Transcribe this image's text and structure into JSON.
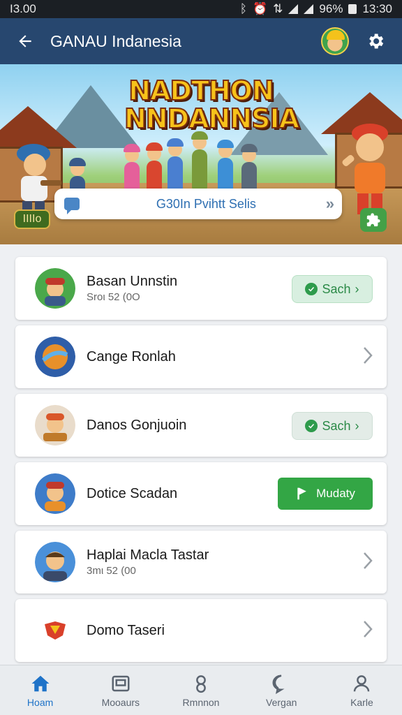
{
  "status_bar": {
    "time_left": "Ι3.00",
    "icons": [
      "bluetooth-icon",
      "alarm-icon",
      "network-icon",
      "signal-icon",
      "signal-icon",
      "battery-icon"
    ],
    "battery": "96%",
    "time_right": "13:30"
  },
  "app_bar": {
    "back_icon": "arrow-left-icon",
    "title": "GANAU Indanesia",
    "settings_icon": "gear-icon"
  },
  "hero": {
    "title_line1": "NADTHON",
    "title_line2": "NNDANNSIA",
    "search_placeholder": "G30In Pvihtt Selis",
    "search_chevron": "»",
    "badge": "ΙΙΙΙο"
  },
  "list": [
    {
      "name": "Basan Unnstin",
      "sub": "Sroι 52 (0O",
      "action": {
        "type": "button-light",
        "label": "Sach",
        "trail": "›"
      }
    },
    {
      "name": "Cange Ronlah",
      "sub": "",
      "action": {
        "type": "chevron"
      }
    },
    {
      "name": "Danos Gonjuoin",
      "sub": "",
      "action": {
        "type": "button-grey",
        "label": "Sach",
        "trail": "›"
      }
    },
    {
      "name": "Dotice Scadan",
      "sub": "",
      "action": {
        "type": "button-green",
        "label": "Mudaty"
      }
    },
    {
      "name": "Haplai Macla Tastar",
      "sub": "3mι 52 (00",
      "action": {
        "type": "chevron"
      }
    },
    {
      "name": "Domo Taseri",
      "sub": "",
      "action": {
        "type": "chevron"
      }
    }
  ],
  "bottom_nav": [
    {
      "label": "Hoam",
      "icon": "home-icon",
      "active": true
    },
    {
      "label": "Mooaurs",
      "icon": "board-icon",
      "active": false
    },
    {
      "label": "Rmnnon",
      "icon": "person-icon",
      "active": false
    },
    {
      "label": "Vergan",
      "icon": "chat-icon",
      "active": false
    },
    {
      "label": "Karle",
      "icon": "profile-icon",
      "active": false
    }
  ],
  "colors": {
    "app_bar": "#27476f",
    "accent_green": "#33a645",
    "active_nav": "#1f73c8"
  }
}
